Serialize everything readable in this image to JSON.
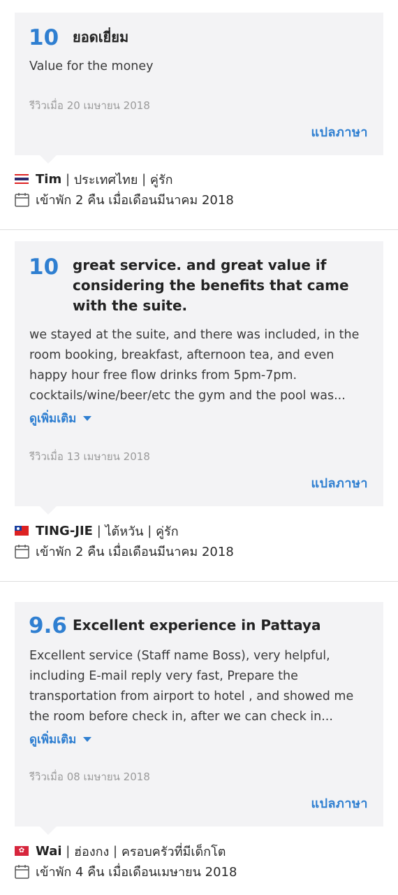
{
  "reviews": [
    {
      "score": "10",
      "title": "ยอดเยี่ยม",
      "body": "Value for the money",
      "show_more": "",
      "date": "รีวิวเมื่อ 20 เมษายน 2018",
      "translate": "แปลภาษา",
      "reviewer": {
        "name": "Tim",
        "country": "ประเทศไทย",
        "type": "คู่รัก",
        "flag": "thailand-flag"
      },
      "stay": "เข้าพัก 2 คืน เมื่อเดือนมีนาคม 2018"
    },
    {
      "score": "10",
      "title": "great service. and great value if considering the benefits that came with the suite.",
      "body": "we stayed at the suite, and there was included, in the room booking, breakfast, afternoon tea, and even happy hour free flow drinks from 5pm-7pm. cocktails/wine/beer/etc the gym and the pool was...",
      "show_more": "ดูเพิ่มเติม",
      "date": "รีวิวเมื่อ 13 เมษายน 2018",
      "translate": "แปลภาษา",
      "reviewer": {
        "name": "TING-JIE",
        "country": "ไต้หวัน",
        "type": "คู่รัก",
        "flag": "taiwan-flag"
      },
      "stay": "เข้าพัก 2 คืน เมื่อเดือนมีนาคม 2018"
    },
    {
      "score": "9.6",
      "title": "Excellent experience in Pattaya",
      "body": "Excellent service (Staff name Boss), very helpful, including E-mail reply very fast, Prepare the transportation from airport to hotel , and showed me the room before check in, after we can check in...",
      "show_more": "ดูเพิ่มเติม",
      "date": "รีวิวเมื่อ 08 เมษายน 2018",
      "translate": "แปลภาษา",
      "reviewer": {
        "name": "Wai",
        "country": "ฮ่องกง",
        "type": "ครอบครัวที่มีเด็กโต",
        "flag": "hong-kong-flag"
      },
      "stay": "เข้าพัก 4 คืน เมื่อเดือนเมษายน 2018"
    }
  ],
  "colors": {
    "accent": "#2f7fd1",
    "card": "#f3f3f5",
    "date": "#9a9a9a"
  }
}
